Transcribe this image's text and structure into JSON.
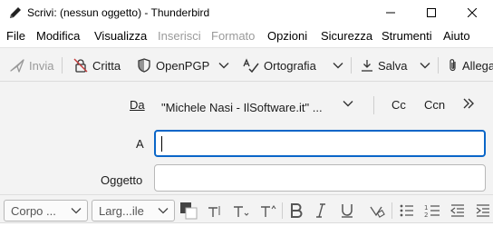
{
  "window": {
    "title": "Scrivi: (nessun oggetto) - Thunderbird",
    "icon": "pencil-icon",
    "controls": [
      "minimize-icon",
      "maximize-icon",
      "close-icon"
    ]
  },
  "menu": {
    "items": [
      {
        "label": "File",
        "enabled": true
      },
      {
        "label": "Modifica",
        "enabled": true
      },
      {
        "label": "Visualizza",
        "enabled": true
      },
      {
        "label": "Inserisci",
        "enabled": false
      },
      {
        "label": "Formato",
        "enabled": false
      },
      {
        "label": "Opzioni",
        "enabled": true
      },
      {
        "label": "Sicurezza",
        "enabled": true
      },
      {
        "label": "Strumenti",
        "enabled": true
      },
      {
        "label": "Aiuto",
        "enabled": true
      }
    ]
  },
  "toolbar": {
    "send_label": "Invia",
    "encrypt_label": "Critta",
    "openpgp_label": "OpenPGP",
    "spelling_label": "Ortografia",
    "save_label": "Salva",
    "attach_label": "Allega"
  },
  "header": {
    "from_label": "Da",
    "from_value": "\"Michele Nasi - IlSoftware.it\" ...",
    "cc_label": "Cc",
    "bcc_label": "Ccn",
    "to_label": "A",
    "to_value": "",
    "subject_label": "Oggetto",
    "subject_value": ""
  },
  "format": {
    "paragraph_select": "Corpo ...",
    "font_select": "Larg...ile"
  },
  "colors": {
    "accent": "#0a66c8",
    "toolbar_bg": "#f3f3f3",
    "disabled_text": "#9a9a9a"
  }
}
